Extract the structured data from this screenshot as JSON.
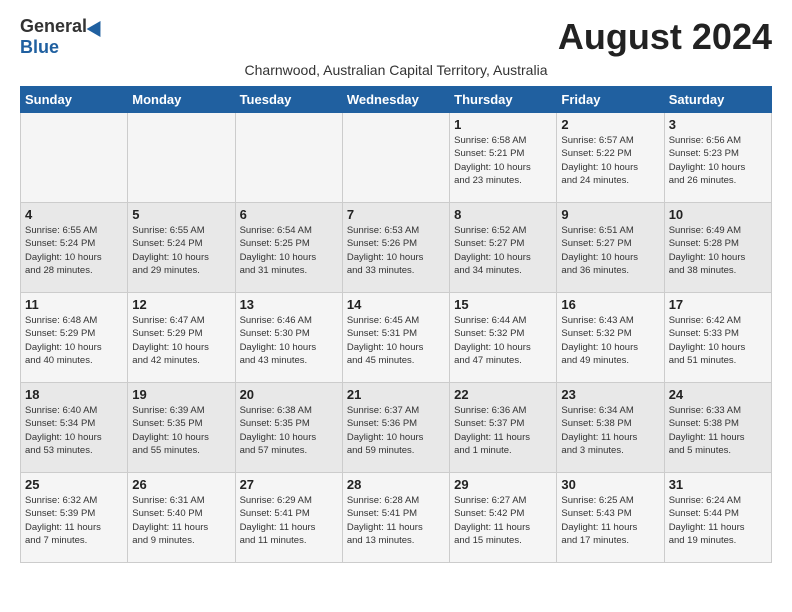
{
  "logo": {
    "general": "General",
    "blue": "Blue"
  },
  "month_year": "August 2024",
  "subtitle": "Charnwood, Australian Capital Territory, Australia",
  "day_headers": [
    "Sunday",
    "Monday",
    "Tuesday",
    "Wednesday",
    "Thursday",
    "Friday",
    "Saturday"
  ],
  "weeks": [
    [
      {
        "day": "",
        "info": ""
      },
      {
        "day": "",
        "info": ""
      },
      {
        "day": "",
        "info": ""
      },
      {
        "day": "",
        "info": ""
      },
      {
        "day": "1",
        "info": "Sunrise: 6:58 AM\nSunset: 5:21 PM\nDaylight: 10 hours\nand 23 minutes."
      },
      {
        "day": "2",
        "info": "Sunrise: 6:57 AM\nSunset: 5:22 PM\nDaylight: 10 hours\nand 24 minutes."
      },
      {
        "day": "3",
        "info": "Sunrise: 6:56 AM\nSunset: 5:23 PM\nDaylight: 10 hours\nand 26 minutes."
      }
    ],
    [
      {
        "day": "4",
        "info": "Sunrise: 6:55 AM\nSunset: 5:24 PM\nDaylight: 10 hours\nand 28 minutes."
      },
      {
        "day": "5",
        "info": "Sunrise: 6:55 AM\nSunset: 5:24 PM\nDaylight: 10 hours\nand 29 minutes."
      },
      {
        "day": "6",
        "info": "Sunrise: 6:54 AM\nSunset: 5:25 PM\nDaylight: 10 hours\nand 31 minutes."
      },
      {
        "day": "7",
        "info": "Sunrise: 6:53 AM\nSunset: 5:26 PM\nDaylight: 10 hours\nand 33 minutes."
      },
      {
        "day": "8",
        "info": "Sunrise: 6:52 AM\nSunset: 5:27 PM\nDaylight: 10 hours\nand 34 minutes."
      },
      {
        "day": "9",
        "info": "Sunrise: 6:51 AM\nSunset: 5:27 PM\nDaylight: 10 hours\nand 36 minutes."
      },
      {
        "day": "10",
        "info": "Sunrise: 6:49 AM\nSunset: 5:28 PM\nDaylight: 10 hours\nand 38 minutes."
      }
    ],
    [
      {
        "day": "11",
        "info": "Sunrise: 6:48 AM\nSunset: 5:29 PM\nDaylight: 10 hours\nand 40 minutes."
      },
      {
        "day": "12",
        "info": "Sunrise: 6:47 AM\nSunset: 5:29 PM\nDaylight: 10 hours\nand 42 minutes."
      },
      {
        "day": "13",
        "info": "Sunrise: 6:46 AM\nSunset: 5:30 PM\nDaylight: 10 hours\nand 43 minutes."
      },
      {
        "day": "14",
        "info": "Sunrise: 6:45 AM\nSunset: 5:31 PM\nDaylight: 10 hours\nand 45 minutes."
      },
      {
        "day": "15",
        "info": "Sunrise: 6:44 AM\nSunset: 5:32 PM\nDaylight: 10 hours\nand 47 minutes."
      },
      {
        "day": "16",
        "info": "Sunrise: 6:43 AM\nSunset: 5:32 PM\nDaylight: 10 hours\nand 49 minutes."
      },
      {
        "day": "17",
        "info": "Sunrise: 6:42 AM\nSunset: 5:33 PM\nDaylight: 10 hours\nand 51 minutes."
      }
    ],
    [
      {
        "day": "18",
        "info": "Sunrise: 6:40 AM\nSunset: 5:34 PM\nDaylight: 10 hours\nand 53 minutes."
      },
      {
        "day": "19",
        "info": "Sunrise: 6:39 AM\nSunset: 5:35 PM\nDaylight: 10 hours\nand 55 minutes."
      },
      {
        "day": "20",
        "info": "Sunrise: 6:38 AM\nSunset: 5:35 PM\nDaylight: 10 hours\nand 57 minutes."
      },
      {
        "day": "21",
        "info": "Sunrise: 6:37 AM\nSunset: 5:36 PM\nDaylight: 10 hours\nand 59 minutes."
      },
      {
        "day": "22",
        "info": "Sunrise: 6:36 AM\nSunset: 5:37 PM\nDaylight: 11 hours\nand 1 minute."
      },
      {
        "day": "23",
        "info": "Sunrise: 6:34 AM\nSunset: 5:38 PM\nDaylight: 11 hours\nand 3 minutes."
      },
      {
        "day": "24",
        "info": "Sunrise: 6:33 AM\nSunset: 5:38 PM\nDaylight: 11 hours\nand 5 minutes."
      }
    ],
    [
      {
        "day": "25",
        "info": "Sunrise: 6:32 AM\nSunset: 5:39 PM\nDaylight: 11 hours\nand 7 minutes."
      },
      {
        "day": "26",
        "info": "Sunrise: 6:31 AM\nSunset: 5:40 PM\nDaylight: 11 hours\nand 9 minutes."
      },
      {
        "day": "27",
        "info": "Sunrise: 6:29 AM\nSunset: 5:41 PM\nDaylight: 11 hours\nand 11 minutes."
      },
      {
        "day": "28",
        "info": "Sunrise: 6:28 AM\nSunset: 5:41 PM\nDaylight: 11 hours\nand 13 minutes."
      },
      {
        "day": "29",
        "info": "Sunrise: 6:27 AM\nSunset: 5:42 PM\nDaylight: 11 hours\nand 15 minutes."
      },
      {
        "day": "30",
        "info": "Sunrise: 6:25 AM\nSunset: 5:43 PM\nDaylight: 11 hours\nand 17 minutes."
      },
      {
        "day": "31",
        "info": "Sunrise: 6:24 AM\nSunset: 5:44 PM\nDaylight: 11 hours\nand 19 minutes."
      }
    ]
  ]
}
